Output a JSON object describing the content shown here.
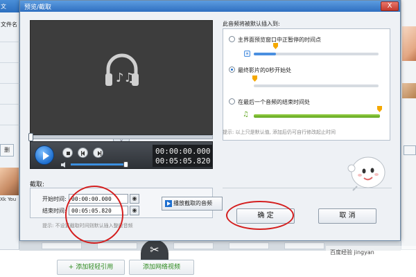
{
  "background": {
    "left_tab": "文",
    "left_column_header": "文件名",
    "left_button": "删",
    "left_thumb_caption": "Xk You",
    "bottom_buttons": [
      "+ 添加轻轻引用",
      "添加网络视频"
    ],
    "scissor_icon": "scissors-icon",
    "watermark": "百度经验  jingyan"
  },
  "dialog": {
    "title": "预览/截取",
    "close_label": "X",
    "preview": {
      "icon": "headphone-music-icon",
      "time_current": "00:00:00.000",
      "time_total": "00:05:05.820",
      "collapse_label": "v"
    },
    "clip": {
      "label": "截取:",
      "start_label": "开始时间:",
      "start_value": "00:00:00.000",
      "end_label": "结束时间:",
      "end_value": "00:05:05.820",
      "play_clip_label": "播放截取的音频",
      "hint": "提示: 不设置截取时间则默认插入整段音频"
    },
    "insert": {
      "title": "此音频将被默认插入到:",
      "options": [
        {
          "label": "主界面预览窗口中正暂停的时间点",
          "selected": false
        },
        {
          "label": "最终影片的0秒开始处",
          "selected": true
        },
        {
          "label": "在最后一个音频的结束时间处",
          "selected": false
        }
      ],
      "hint": "提示: 以上只是默认值, 添加后仍可自行修改起止时间",
      "accent_color": "#4a8fe0",
      "marker_color": "#f5a800"
    },
    "ok_label": "确  定",
    "cancel_label": "取  消"
  },
  "annotation_color": "#d41e1e"
}
